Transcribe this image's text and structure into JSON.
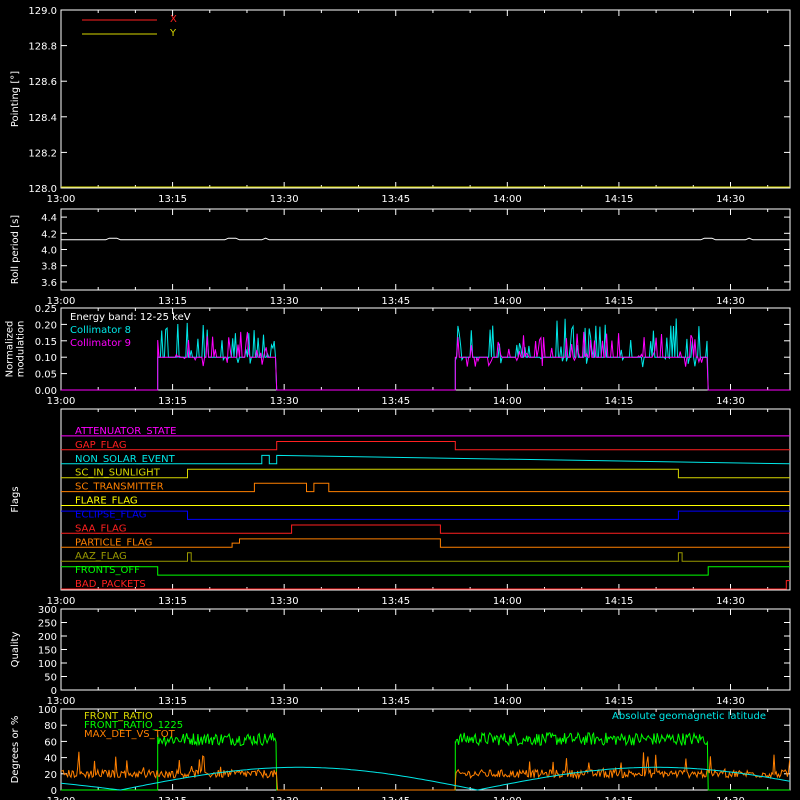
{
  "colors": {
    "background": "#000000",
    "axes": "#ffffff",
    "x_pointing": "#ff2020",
    "y_pointing": "#d8d800",
    "collimator8": "#00e8e8",
    "collimator9": "#ff00ff",
    "front_ratio": "#d8d800",
    "front_ratio_1225": "#00ff00",
    "max_det": "#ff8000",
    "geomag": "#00e8e8"
  },
  "time_axis": {
    "ticks": [
      "13:00",
      "13:15",
      "13:30",
      "13:45",
      "14:00",
      "14:15",
      "14:30"
    ],
    "range_minutes": [
      0,
      98
    ]
  },
  "chart_data": [
    {
      "type": "line",
      "ylabel": "Pointing [°]",
      "yticks": [
        "128.0",
        "128.2",
        "128.4",
        "128.6",
        "128.8",
        "129.0"
      ],
      "ylim": [
        128.0,
        129.0
      ],
      "legend": [
        "X",
        "Y"
      ],
      "series": [
        {
          "name": "X",
          "x": [],
          "values": []
        },
        {
          "name": "Y",
          "x": [],
          "values": []
        }
      ]
    },
    {
      "type": "line",
      "ylabel": "Roll period [s]",
      "yticks": [
        "3.6",
        "3.8",
        "4.0",
        "4.2",
        "4.4"
      ],
      "ylim": [
        3.5,
        4.5
      ],
      "series": [
        {
          "x": [
            0,
            98
          ],
          "values": [
            4.12,
            4.12
          ]
        }
      ]
    },
    {
      "type": "line",
      "ylabel": "Normalized modulation",
      "yticks": [
        "0.00",
        "0.05",
        "0.10",
        "0.15",
        "0.20",
        "0.25"
      ],
      "ylim": [
        0,
        0.25
      ],
      "legend": [
        "Energy band: 12-25 keV",
        "Collimator 8",
        "Collimator 9"
      ],
      "series": [
        {
          "name": "Collimator 8",
          "x": [
            0,
            13,
            13,
            29,
            29,
            53,
            53,
            87,
            87,
            98
          ],
          "values": [
            0,
            0,
            0.1,
            0.1,
            0,
            0,
            0.1,
            0.1,
            0,
            0
          ]
        },
        {
          "name": "Collimator 9",
          "x": [
            0,
            13,
            13,
            29,
            29,
            53,
            53,
            87,
            87,
            98
          ],
          "values": [
            0,
            0,
            0.1,
            0.1,
            0,
            0,
            0.1,
            0.1,
            0,
            0
          ]
        }
      ]
    },
    {
      "type": "line",
      "ylabel": "Flags",
      "flags": [
        {
          "name": "ATTENUATOR_STATE",
          "color": "#ff00ff",
          "x": [
            0,
            98
          ],
          "values": [
            0,
            0
          ]
        },
        {
          "name": "GAP_FLAG",
          "color": "#ff2020",
          "x": [
            0,
            29,
            29,
            53,
            53,
            98
          ],
          "values": [
            0,
            0,
            1,
            1,
            0,
            0
          ]
        },
        {
          "name": "NON_SOLAR_EVENT",
          "color": "#00e8e8",
          "x": [
            0,
            27,
            27,
            28,
            28,
            29,
            29,
            98
          ],
          "values": [
            0,
            0,
            1,
            1,
            0,
            0,
            1,
            0
          ]
        },
        {
          "name": "SC_IN_SUNLIGHT",
          "color": "#d8d800",
          "x": [
            0,
            17,
            17,
            83,
            83,
            98
          ],
          "values": [
            0,
            0,
            1,
            1,
            0,
            0
          ]
        },
        {
          "name": "SC_TRANSMITTER",
          "color": "#ff8000",
          "x": [
            0,
            26,
            26,
            33,
            33,
            34,
            34,
            36,
            36,
            98
          ],
          "values": [
            0,
            0,
            1,
            1,
            0,
            0,
            1,
            1,
            0,
            0
          ]
        },
        {
          "name": "FLARE_FLAG",
          "color": "#ffff00",
          "x": [
            0,
            98
          ],
          "values": [
            0,
            0
          ]
        },
        {
          "name": "ECLIPSE_FLAG",
          "color": "#0000ff",
          "x": [
            0,
            17,
            17,
            83,
            83,
            98
          ],
          "values": [
            1,
            1,
            0,
            0,
            1,
            1
          ]
        },
        {
          "name": "SAA_FLAG",
          "color": "#ff2020",
          "x": [
            0,
            31,
            31,
            51,
            51,
            98
          ],
          "values": [
            0,
            0,
            1,
            1,
            0,
            0
          ]
        },
        {
          "name": "PARTICLE_FLAG",
          "color": "#ff8000",
          "x": [
            0,
            23,
            23,
            24,
            24,
            51,
            51,
            98
          ],
          "values": [
            0,
            0,
            0.5,
            0.5,
            1,
            1,
            0,
            0
          ]
        },
        {
          "name": "AAZ_FLAG",
          "color": "#999900",
          "x": [
            0,
            17,
            17,
            17.5,
            17.5,
            83,
            83,
            83.5,
            83.5,
            98
          ],
          "values": [
            0,
            0,
            1,
            1,
            0,
            0,
            1,
            1,
            0,
            0
          ]
        },
        {
          "name": "FRONTS_OFF",
          "color": "#00ff00",
          "x": [
            0,
            13,
            13,
            87,
            87,
            98
          ],
          "values": [
            1,
            1,
            0,
            0,
            1,
            1
          ]
        },
        {
          "name": "BAD_PACKETS",
          "color": "#ff2020",
          "x": [
            0,
            97.5,
            97.5,
            98
          ],
          "values": [
            0,
            0,
            1,
            1
          ]
        }
      ]
    },
    {
      "type": "line",
      "ylabel": "Quality",
      "yticks": [
        "0",
        "50",
        "100",
        "150",
        "200",
        "250",
        "300"
      ],
      "ylim": [
        0,
        300
      ],
      "series": []
    },
    {
      "type": "line",
      "ylabel": "Degrees or %",
      "yticks": [
        "0",
        "20",
        "40",
        "60",
        "80",
        "100"
      ],
      "ylim": [
        0,
        100
      ],
      "legend": [
        "FRONT_RATIO",
        "FRONT_RATIO_1225",
        "MAX_DET_VS_TOT"
      ],
      "annotation": "Absolute geomagnetic latitude",
      "series": [
        {
          "name": "FRONT_RATIO",
          "x": [],
          "values": []
        },
        {
          "name": "FRONT_RATIO_1225",
          "x": [
            0,
            13,
            13,
            29,
            29,
            53,
            53,
            87,
            87,
            98
          ],
          "values": [
            0,
            0,
            60,
            60,
            0,
            0,
            60,
            60,
            0,
            0
          ]
        },
        {
          "name": "MAX_DET_VS_TOT",
          "x": [
            0,
            13,
            13,
            29,
            29,
            53,
            53,
            87,
            87,
            98
          ],
          "values": [
            20,
            20,
            18,
            18,
            0,
            0,
            18,
            18,
            20,
            20
          ]
        },
        {
          "name": "Absolute geomagnetic latitude",
          "x": [
            0,
            8,
            32,
            56,
            80,
            98
          ],
          "values": [
            15,
            0,
            28,
            0,
            25,
            10
          ]
        }
      ]
    }
  ]
}
